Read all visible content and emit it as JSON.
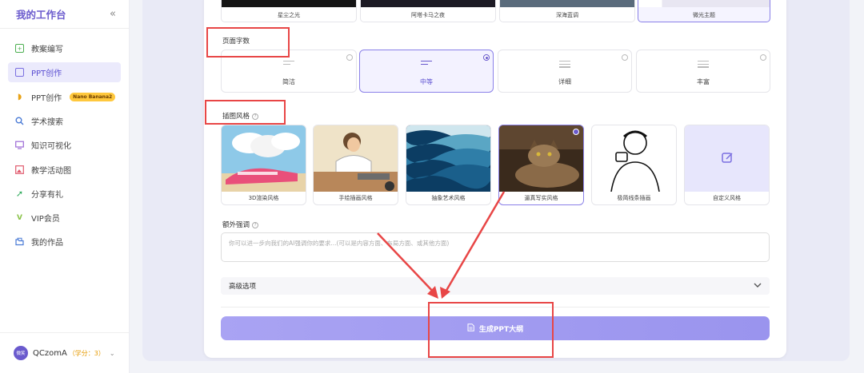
{
  "sidebar": {
    "title": "我的工作台",
    "collapse_icon": "double-chevron-left-icon",
    "items": [
      {
        "label": "教案编写",
        "icon": "doc-plus-icon",
        "color": "#4caf50"
      },
      {
        "label": "PPT创作",
        "icon": "ppt-icon",
        "color": "#7a6fe0",
        "active": true
      },
      {
        "label": "PPT创作",
        "icon": "banana-icon",
        "color": "#e8a317",
        "badge": "Nano Banana2"
      },
      {
        "label": "学术搜索",
        "icon": "search-icon",
        "color": "#4a7bd6"
      },
      {
        "label": "知识可视化",
        "icon": "monitor-icon",
        "color": "#9c6ad6"
      },
      {
        "label": "教学活动图",
        "icon": "image-icon",
        "color": "#e05a6d"
      },
      {
        "label": "分享有礼",
        "icon": "share-arrow-icon",
        "color": "#2eaa5a"
      },
      {
        "label": "VIP会员",
        "icon": "vip-icon",
        "color": "#8bc34a"
      },
      {
        "label": "我的作品",
        "icon": "folder-icon",
        "color": "#4a7bd6"
      }
    ],
    "user": {
      "avatar_text": "微笑",
      "name": "QCzomA",
      "credits": "（学分：3）"
    }
  },
  "themes": [
    {
      "label": "星尘之光"
    },
    {
      "label": "阿塔卡马之夜"
    },
    {
      "label": "深海蓝调"
    },
    {
      "label": "微光主题",
      "selected": true
    }
  ],
  "word_count": {
    "label": "页面字数",
    "options": [
      {
        "label": "简洁",
        "lines": 2
      },
      {
        "label": "中等",
        "lines": 2,
        "selected": true
      },
      {
        "label": "详细",
        "lines": 3
      },
      {
        "label": "丰富",
        "lines": 3
      }
    ]
  },
  "illustration": {
    "label": "插图风格",
    "options": [
      {
        "label": "3D渲染风格"
      },
      {
        "label": "手绘插画风格"
      },
      {
        "label": "抽象艺术风格"
      },
      {
        "label": "逼真写实风格",
        "selected": true
      },
      {
        "label": "极简线条插画"
      },
      {
        "label": "自定义风格"
      }
    ]
  },
  "emphasis": {
    "label": "额外强调",
    "placeholder": "你可以进一步向我们的AI强调你的要求...(可以是内容方面、布局方面、或其他方面)"
  },
  "advanced": {
    "label": "高级选项"
  },
  "generate": {
    "label": "生成PPT大纲"
  }
}
